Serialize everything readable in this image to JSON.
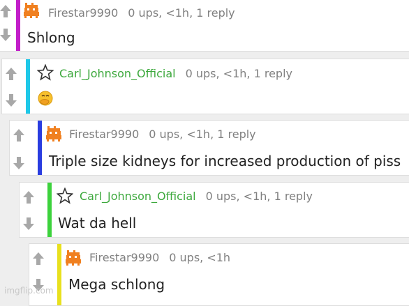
{
  "comments": [
    {
      "username": "Firestar9990",
      "meta": "0 ups, <1h, 1 reply",
      "text": "Shlong",
      "bar_color": "#c21ec9",
      "avatar": "orange-pixel-avatar"
    },
    {
      "username": "Carl_Johnson_Official",
      "meta": "0 ups, <1h, 1 reply",
      "text": "",
      "emoji": "face-with-hand-over-mouth-emoji",
      "bar_color": "#1ec8e8",
      "avatar": "star-outline-icon"
    },
    {
      "username": "Firestar9990",
      "meta": "0 ups, <1h, 1 reply",
      "text": "Triple size kidneys for increased production of piss",
      "bar_color": "#2a3de0",
      "avatar": "orange-pixel-avatar"
    },
    {
      "username": "Carl_Johnson_Official",
      "meta": "0 ups, <1h, 1 reply",
      "text": "Wat da hell",
      "bar_color": "#3cd23c",
      "avatar": "star-outline-icon"
    },
    {
      "username": "Firestar9990",
      "meta": "0 ups, <1h",
      "text": "Mega schlong",
      "bar_color": "#e8e01e",
      "avatar": "orange-pixel-avatar"
    }
  ],
  "watermark": "imgflip.com",
  "colors": {
    "username_green": "#3ca83c",
    "meta_gray": "#808080",
    "arrow_gray": "#a8a8a8"
  }
}
